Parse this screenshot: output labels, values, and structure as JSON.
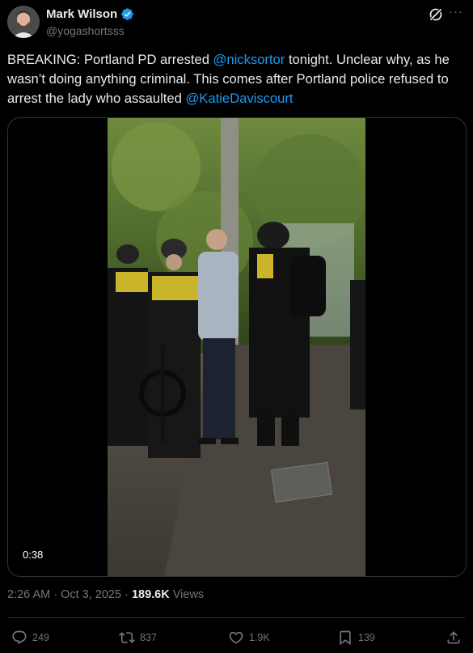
{
  "author": {
    "name": "Mark Wilson",
    "handle": "@yogashortsss",
    "verified": true
  },
  "tweet": {
    "text_1": "BREAKING: Portland PD arrested ",
    "mention_1": "@nicksortor",
    "text_2": " tonight. Unclear why, as he wasn’t doing anything criminal. This comes after Portland police refused to arrest the lady who assaulted ",
    "mention_2": "@KatieDaviscourt"
  },
  "media": {
    "type": "video",
    "duration": "0:38"
  },
  "meta": {
    "time": "2:26 AM",
    "separator": " · ",
    "date": "Oct 3, 2025",
    "views_count": "189.6K",
    "views_label": " Views"
  },
  "actions": {
    "replies": "249",
    "reposts": "837",
    "likes": "1.9K",
    "bookmarks": "139"
  },
  "colors": {
    "background": "#000000",
    "text": "#e7e9ea",
    "secondary": "#71767b",
    "accent": "#1d9bf0",
    "border": "#2f3336"
  },
  "icons": [
    "verified-badge-icon",
    "grok-icon",
    "more-icon",
    "reply-icon",
    "repost-icon",
    "like-icon",
    "bookmark-icon",
    "share-icon"
  ]
}
